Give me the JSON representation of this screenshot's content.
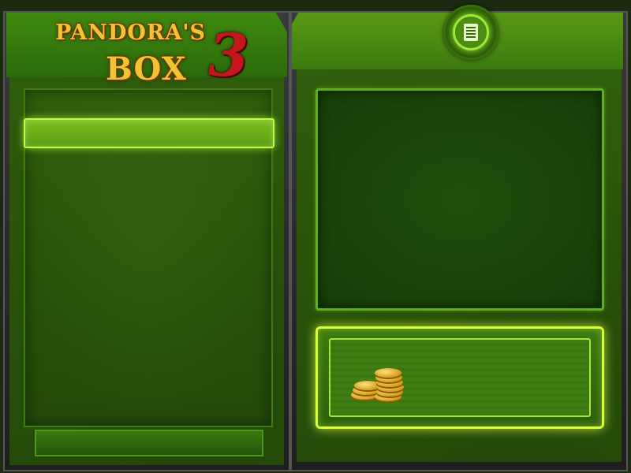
{
  "game": {
    "logo_line1": "PANDORA'S",
    "logo_line2": "BOX",
    "logo_number": "3"
  },
  "right_panel": {
    "news_icon": "newspaper-icon",
    "display_text": "",
    "coin_value": ""
  },
  "colors": {
    "accent_green": "#7bd11e",
    "highlight": "#d7ff3a",
    "logo_gold": "#f3c431",
    "logo_red": "#c4161c"
  }
}
